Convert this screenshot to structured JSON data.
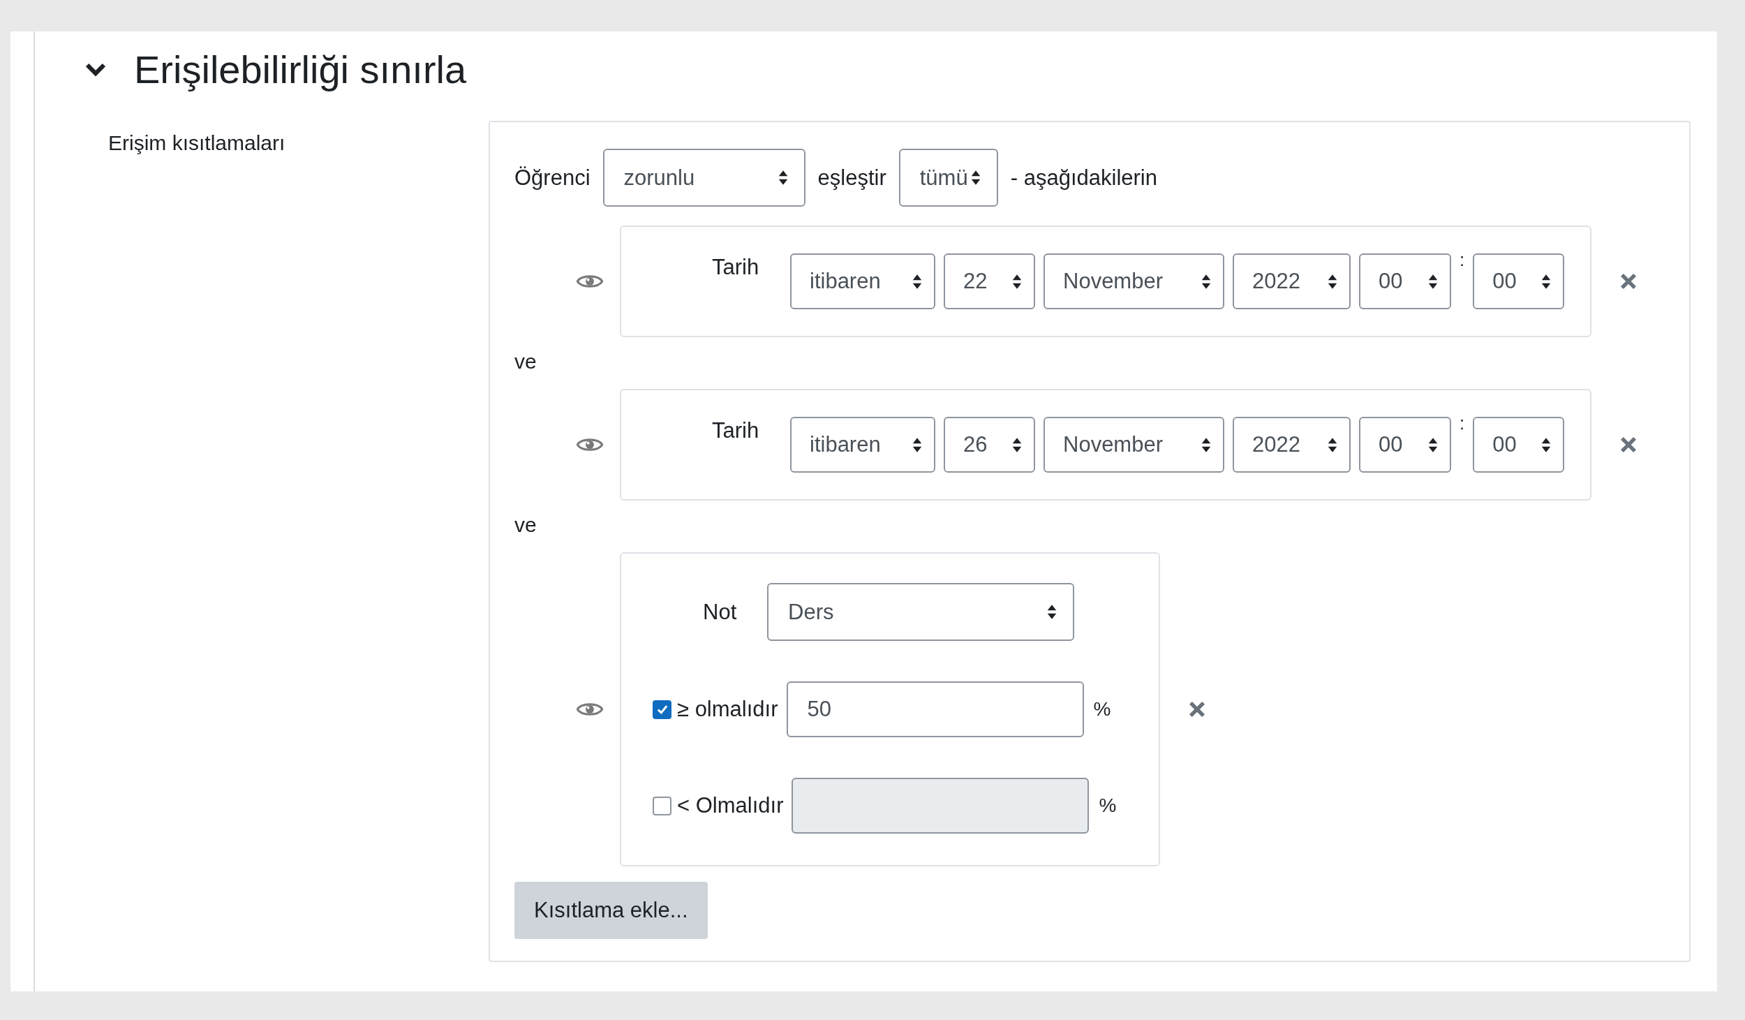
{
  "section": {
    "title": "Erişilebilirliği sınırla",
    "expanded": true
  },
  "field_label": "Erişim kısıtlamaları",
  "match_row": {
    "prefix": "Öğrenci",
    "mode": "zorunlu",
    "middle": "eşleştir",
    "scope": "tümü",
    "suffix": "- aşağıdakilerin"
  },
  "conditions": [
    {
      "kind": "date",
      "label": "Tarih",
      "direction": "itibaren",
      "day": "22",
      "month": "November",
      "year": "2022",
      "hour": "00",
      "separator": ":",
      "minute": "00"
    },
    {
      "kind": "date",
      "connector": "ve",
      "label": "Tarih",
      "direction": "itibaren",
      "day": "26",
      "month": "November",
      "year": "2022",
      "hour": "00",
      "separator": ":",
      "minute": "00"
    },
    {
      "kind": "grade",
      "connector": "ve",
      "label": "Not",
      "item": "Ders",
      "limits": [
        {
          "checked": true,
          "operator": "≥",
          "label": "olmalıdır",
          "value": "50",
          "unit": "%"
        },
        {
          "checked": false,
          "operator": "<",
          "label": "Olmalıdır",
          "unit": "%"
        }
      ]
    }
  ],
  "add_button": "Kısıtlama ekle..."
}
